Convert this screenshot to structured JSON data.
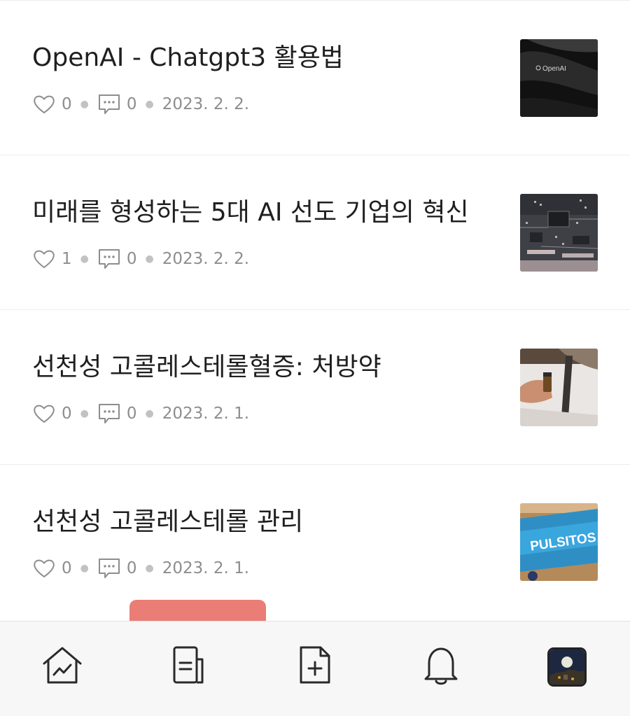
{
  "posts": [
    {
      "title": "OpenAI - Chatgpt3 활용법",
      "likes": "0",
      "comments": "0",
      "date": "2023. 2. 2.",
      "thumbnail": "openai-photo"
    },
    {
      "title": "미래를 형성하는 5대 AI 선도 기업의 혁신",
      "likes": "1",
      "comments": "0",
      "date": "2023. 2. 2.",
      "thumbnail": "circuit-board-photo"
    },
    {
      "title": "선천성 고콜레스테롤혈증: 처방약",
      "likes": "0",
      "comments": "0",
      "date": "2023. 2. 1.",
      "thumbnail": "medicine-vial-photo"
    },
    {
      "title": "선천성 고콜레스테롤 관리",
      "likes": "0",
      "comments": "0",
      "date": "2023. 2. 1.",
      "thumbnail": "pulsitos-snack-photo"
    }
  ],
  "thumb_openai_text": "OpenAI",
  "thumb_pulsitos_text": "PULSITOS",
  "bottom_nav": [
    {
      "icon": "home-chart-icon"
    },
    {
      "icon": "document-icon"
    },
    {
      "icon": "new-post-icon"
    },
    {
      "icon": "bell-icon"
    },
    {
      "icon": "profile-avatar"
    }
  ],
  "colors": {
    "text": "#1f1f1f",
    "meta": "#8d8d8d",
    "divider": "#ececec",
    "highlight": "#e8726a",
    "nav_bg": "#f7f7f7"
  }
}
